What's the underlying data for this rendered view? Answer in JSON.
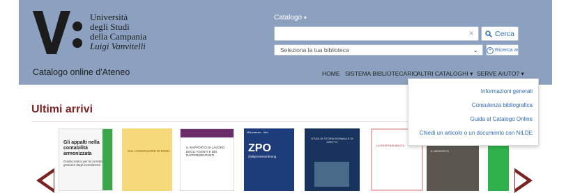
{
  "header": {
    "logo": {
      "line1": "Università",
      "line2": "degli Studi",
      "line3": "della Campania",
      "line4": "Luigi Vanvitelli"
    },
    "site_title": "Catalogo online d'Ateneo"
  },
  "search": {
    "scope_label": "Catalogo",
    "placeholder": "",
    "button_label": "Cerca",
    "library_select_value": "Seleziona la tua biblioteca",
    "advanced_label": "Ricerca avanzata"
  },
  "nav": {
    "home": "HOME",
    "sistema": "SISTEMA BIBLIOTECARIO",
    "altri": "ALTRI CATALOGHI",
    "aiuto": "SERVE AIUTO?"
  },
  "help_menu": [
    "Informazioni generali",
    "Consulenza bibliografica",
    "Guida al Catalogo Online",
    "Chiedi un articolo o un documento con NILDE"
  ],
  "section": {
    "title": "Ultimi arrivi"
  },
  "books": {
    "b1": {
      "title": "Gli appalti nella contabilità armonizzata",
      "subtitle": "Guida pratica per la corretta gestione degli investimenti"
    },
    "b2": {
      "title": "SUL CONSIGLIERE DI ROMA"
    },
    "b3": {
      "title": "IL RAPPORTO DI LAVORO DEGLI AGENTI E DEI RAPPRESENTANTI"
    },
    "b4": {
      "publisher": "Münchener · Verl.",
      "title": "ZPO",
      "subtitle": "Zivilprozessordnung"
    },
    "b5": {
      "title": "STUDI DI STORIA ROMANA E DI DIRITTO"
    },
    "b6": {
      "title": "LA RESPONSABILITÀ"
    },
    "b7": {
      "title": "IL MEDIOEVO"
    }
  },
  "colors": {
    "header_bg": "#8ca1c0",
    "accent": "#7a2424",
    "link": "#2f6bb6"
  }
}
